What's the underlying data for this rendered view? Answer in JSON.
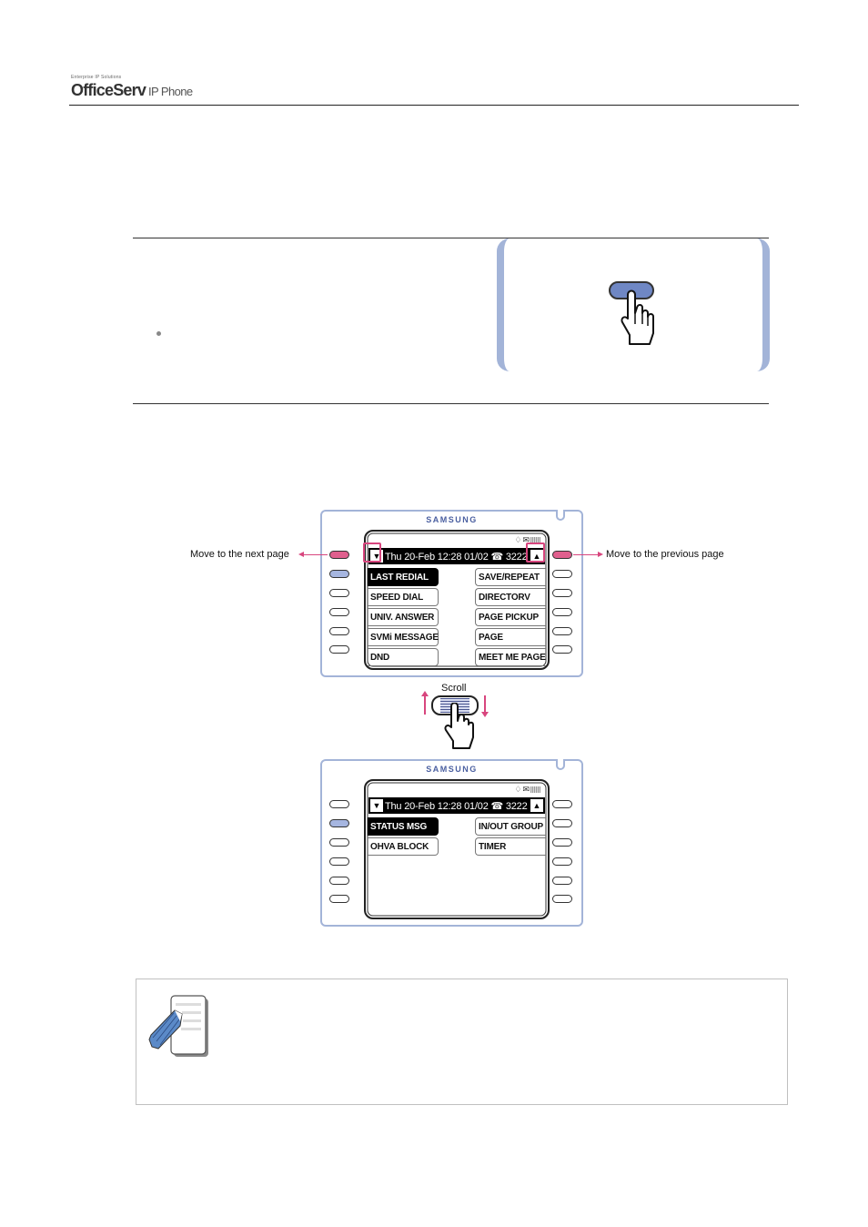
{
  "header": {
    "tagline": "Enterprise IP Solutions",
    "brand": "OfficeServ",
    "product": "IP Phone"
  },
  "colors": {
    "accent_pink": "#d8467e",
    "accent_blue": "#a3b4d8",
    "brand_blue": "#4a5fa0"
  },
  "diagram": {
    "callouts": {
      "next_page": "Move to the next page",
      "previous_page": "Move to the previous page",
      "scroll": "Scroll"
    },
    "phone_top": {
      "brand": "SAMSUNG",
      "status_bar": "Thu 20-Feb 12:28  01/02 ☎ 3222",
      "down_arrow": "▼",
      "up_arrow": "▲",
      "left_keys": [
        {
          "label": "LAST REDIAL",
          "selected": true
        },
        {
          "label": "SPEED DIAL",
          "selected": false
        },
        {
          "label": "UNIV. ANSWER",
          "selected": false
        },
        {
          "label": "SVMi MESSAGE",
          "selected": false
        },
        {
          "label": "DND",
          "selected": false
        }
      ],
      "right_keys": [
        {
          "label": "SAVE/REPEAT"
        },
        {
          "label": "DIRECTORV"
        },
        {
          "label": "PAGE PICKUP"
        },
        {
          "label": "PAGE"
        },
        {
          "label": "MEET ME PAGE"
        }
      ]
    },
    "phone_bottom": {
      "brand": "SAMSUNG",
      "status_bar": "Thu 20-Feb 12:28  01/02 ☎ 3222",
      "down_arrow": "▼",
      "up_arrow": "▲",
      "left_keys": [
        {
          "label": "STATUS MSG",
          "selected": true
        },
        {
          "label": "OHVA BLOCK",
          "selected": false
        }
      ],
      "right_keys": [
        {
          "label": "IN/OUT GROUP"
        },
        {
          "label": "TIMER"
        }
      ]
    },
    "status_icons": [
      "bell-icon",
      "mail-icon",
      "battery-icon"
    ]
  }
}
